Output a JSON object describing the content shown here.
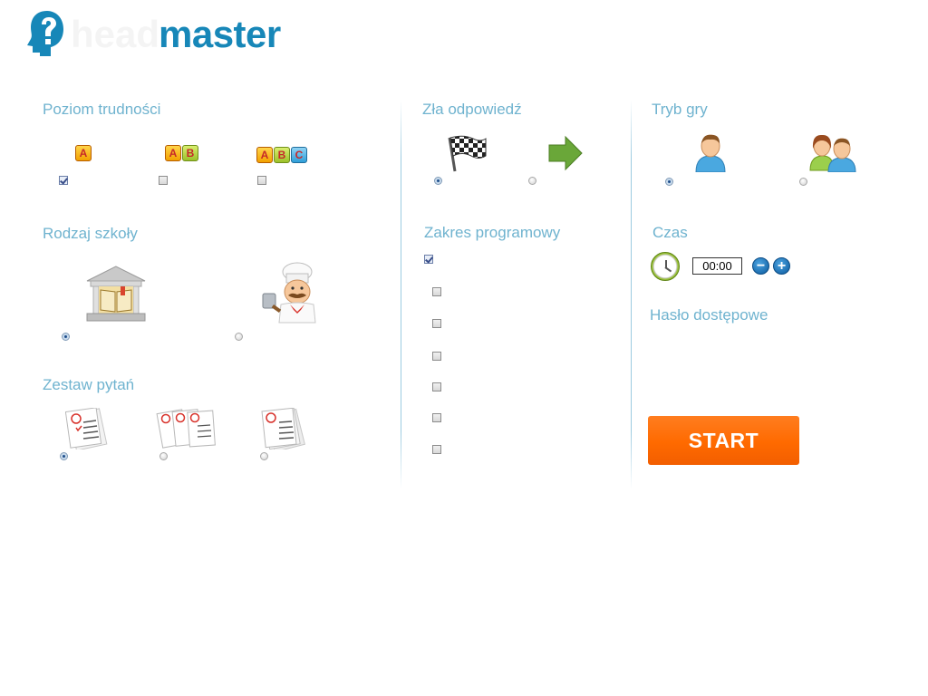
{
  "brand": {
    "logo_ghost_text": "head",
    "logo_text": "master",
    "logo_color": "#1787b8"
  },
  "sections": {
    "difficulty": {
      "title": "Poziom trudności",
      "levels": [
        {
          "letters": [
            "A"
          ],
          "checked": true
        },
        {
          "letters": [
            "A",
            "B"
          ],
          "checked": false
        },
        {
          "letters": [
            "A",
            "B",
            "C"
          ],
          "checked": false
        }
      ]
    },
    "school_type": {
      "title": "Rodzaj szkoły",
      "options": [
        {
          "icon": "school-building-icon",
          "selected": true
        },
        {
          "icon": "chef-icon",
          "selected": false
        }
      ]
    },
    "question_set": {
      "title": "Zestaw pytań",
      "options": [
        {
          "icon": "single-test-sheet-icon",
          "selected": true
        },
        {
          "icon": "multiple-test-sheets-icon",
          "selected": false
        },
        {
          "icon": "test-sheet-stack-icon",
          "selected": false
        }
      ]
    },
    "wrong_answer": {
      "title": "Zła odpowiedź",
      "options": [
        {
          "icon": "checkered-flag-icon",
          "selected": true
        },
        {
          "icon": "green-arrow-icon",
          "selected": false
        }
      ]
    },
    "curriculum": {
      "title": "Zakres programowy",
      "items": [
        {
          "checked": true
        },
        {
          "checked": false
        },
        {
          "checked": false
        },
        {
          "checked": false
        },
        {
          "checked": false
        },
        {
          "checked": false
        },
        {
          "checked": false
        }
      ]
    },
    "game_mode": {
      "title": "Tryb gry",
      "options": [
        {
          "icon": "single-player-icon",
          "selected": true
        },
        {
          "icon": "multi-player-icon",
          "selected": false
        }
      ]
    },
    "time": {
      "title": "Czas",
      "value": "00:00",
      "minus_label": "−",
      "plus_label": "+"
    },
    "password": {
      "title": "Hasło dostępowe"
    }
  },
  "start_label": "START",
  "colors": {
    "heading": "#6fb3cf",
    "start": "#ff6a00",
    "divider": "#9ccbe0"
  }
}
